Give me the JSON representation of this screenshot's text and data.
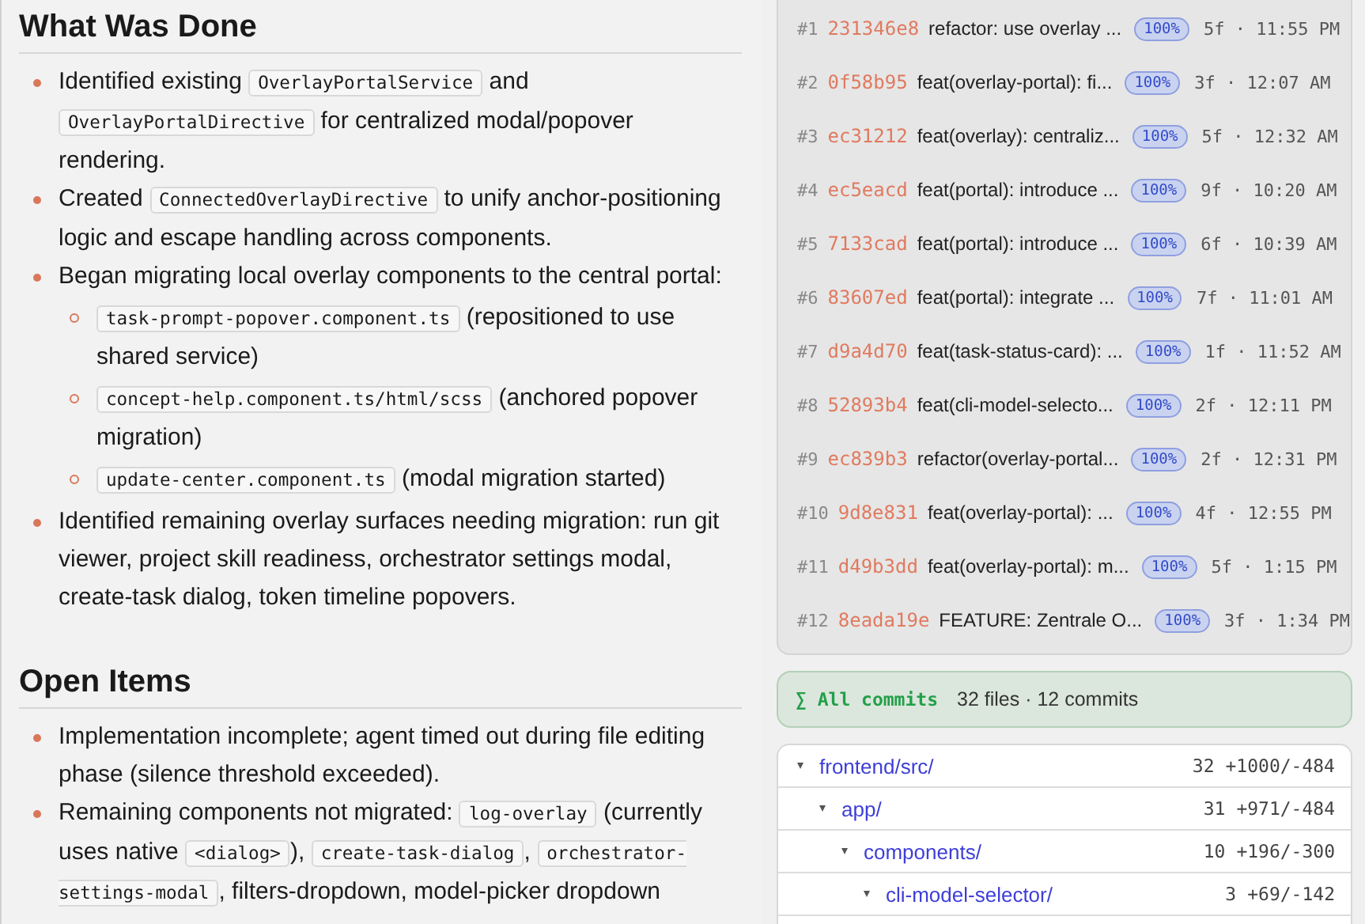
{
  "summary": {
    "sections": [
      {
        "heading": "What Was Done",
        "items": [
          {
            "parts": [
              {
                "kind": "text",
                "text": "Identified existing "
              },
              {
                "kind": "code",
                "text": "OverlayPortalService"
              },
              {
                "kind": "text",
                "text": " and "
              },
              {
                "kind": "code",
                "text": "OverlayPortalDirective"
              },
              {
                "kind": "text",
                "text": " for centralized modal/popover rendering."
              }
            ]
          },
          {
            "parts": [
              {
                "kind": "text",
                "text": "Created "
              },
              {
                "kind": "code",
                "text": "ConnectedOverlayDirective"
              },
              {
                "kind": "text",
                "text": " to unify anchor-positioning logic and escape handling across components."
              }
            ]
          },
          {
            "parts": [
              {
                "kind": "text",
                "text": "Began migrating local overlay components to the central portal:"
              }
            ],
            "children": [
              {
                "parts": [
                  {
                    "kind": "code",
                    "text": "task-prompt-popover.component.ts"
                  },
                  {
                    "kind": "text",
                    "text": " (repositioned to use shared service)"
                  }
                ]
              },
              {
                "parts": [
                  {
                    "kind": "code",
                    "text": "concept-help.component.ts/html/scss"
                  },
                  {
                    "kind": "text",
                    "text": " (anchored popover migration)"
                  }
                ]
              },
              {
                "parts": [
                  {
                    "kind": "code",
                    "text": "update-center.component.ts"
                  },
                  {
                    "kind": "text",
                    "text": " (modal migration started)"
                  }
                ]
              }
            ]
          },
          {
            "parts": [
              {
                "kind": "text",
                "text": "Identified remaining overlay surfaces needing migration: run git viewer, project skill readiness, orchestrator settings modal, create-task dialog, token timeline popovers."
              }
            ]
          }
        ]
      },
      {
        "heading": "Open Items",
        "items": [
          {
            "parts": [
              {
                "kind": "text",
                "text": "Implementation incomplete; agent timed out during file editing phase (silence threshold exceeded)."
              }
            ]
          },
          {
            "parts": [
              {
                "kind": "text",
                "text": "Remaining components not migrated: "
              },
              {
                "kind": "code",
                "text": "log-overlay"
              },
              {
                "kind": "text",
                "text": " (currently uses native "
              },
              {
                "kind": "code",
                "text": "<dialog>"
              },
              {
                "kind": "text",
                "text": "), "
              },
              {
                "kind": "code",
                "text": "create-task-dialog"
              },
              {
                "kind": "text",
                "text": ", "
              },
              {
                "kind": "code",
                "text": "orchestrator-settings-modal"
              },
              {
                "kind": "text",
                "text": ", filters-dropdown, model-picker dropdown"
              }
            ]
          }
        ]
      }
    ]
  },
  "commits": [
    {
      "index": "#1",
      "hash": "231346e8",
      "message": "refactor: use overlay ...",
      "badge": "100%",
      "meta": "5f · 11:55 PM"
    },
    {
      "index": "#2",
      "hash": "0f58b95",
      "message": "feat(overlay-portal): fi...",
      "badge": "100%",
      "meta": "3f · 12:07 AM"
    },
    {
      "index": "#3",
      "hash": "ec31212",
      "message": "feat(overlay): centraliz...",
      "badge": "100%",
      "meta": "5f · 12:32 AM"
    },
    {
      "index": "#4",
      "hash": "ec5eacd",
      "message": "feat(portal): introduce ...",
      "badge": "100%",
      "meta": "9f · 10:20 AM"
    },
    {
      "index": "#5",
      "hash": "7133cad",
      "message": "feat(portal): introduce ...",
      "badge": "100%",
      "meta": "6f · 10:39 AM"
    },
    {
      "index": "#6",
      "hash": "83607ed",
      "message": "feat(portal): integrate ...",
      "badge": "100%",
      "meta": "7f · 11:01 AM"
    },
    {
      "index": "#7",
      "hash": "d9a4d70",
      "message": "feat(task-status-card): ...",
      "badge": "100%",
      "meta": "1f · 11:52 AM"
    },
    {
      "index": "#8",
      "hash": "52893b4",
      "message": "feat(cli-model-selecto...",
      "badge": "100%",
      "meta": "2f · 12:11 PM"
    },
    {
      "index": "#9",
      "hash": "ec839b3",
      "message": "refactor(overlay-portal...",
      "badge": "100%",
      "meta": "2f · 12:31 PM"
    },
    {
      "index": "#10",
      "hash": "9d8e831",
      "message": "feat(overlay-portal): ...",
      "badge": "100%",
      "meta": "4f · 12:55 PM"
    },
    {
      "index": "#11",
      "hash": "d49b3dd",
      "message": "feat(overlay-portal): m...",
      "badge": "100%",
      "meta": "5f · 1:15 PM"
    },
    {
      "index": "#12",
      "hash": "8eada19e",
      "message": "FEATURE: Zentrale O...",
      "badge": "100%",
      "meta": "3f · 1:34 PM"
    }
  ],
  "all_commits": {
    "label": "∑ All commits",
    "detail": "32 files · 12 commits"
  },
  "file_tree": [
    {
      "name": "frontend/src/",
      "count": "32",
      "diff": "+1000/-484",
      "expanded": true,
      "children": [
        {
          "name": "app/",
          "count": "31",
          "diff": "+971/-484",
          "expanded": true,
          "children": [
            {
              "name": "components/",
              "count": "10",
              "diff": "+196/-300",
              "expanded": true,
              "children": [
                {
                  "name": "cli-model-selector/",
                  "count": "3",
                  "diff": "+69/-142",
                  "expanded": true
                }
              ]
            }
          ]
        }
      ]
    }
  ]
}
